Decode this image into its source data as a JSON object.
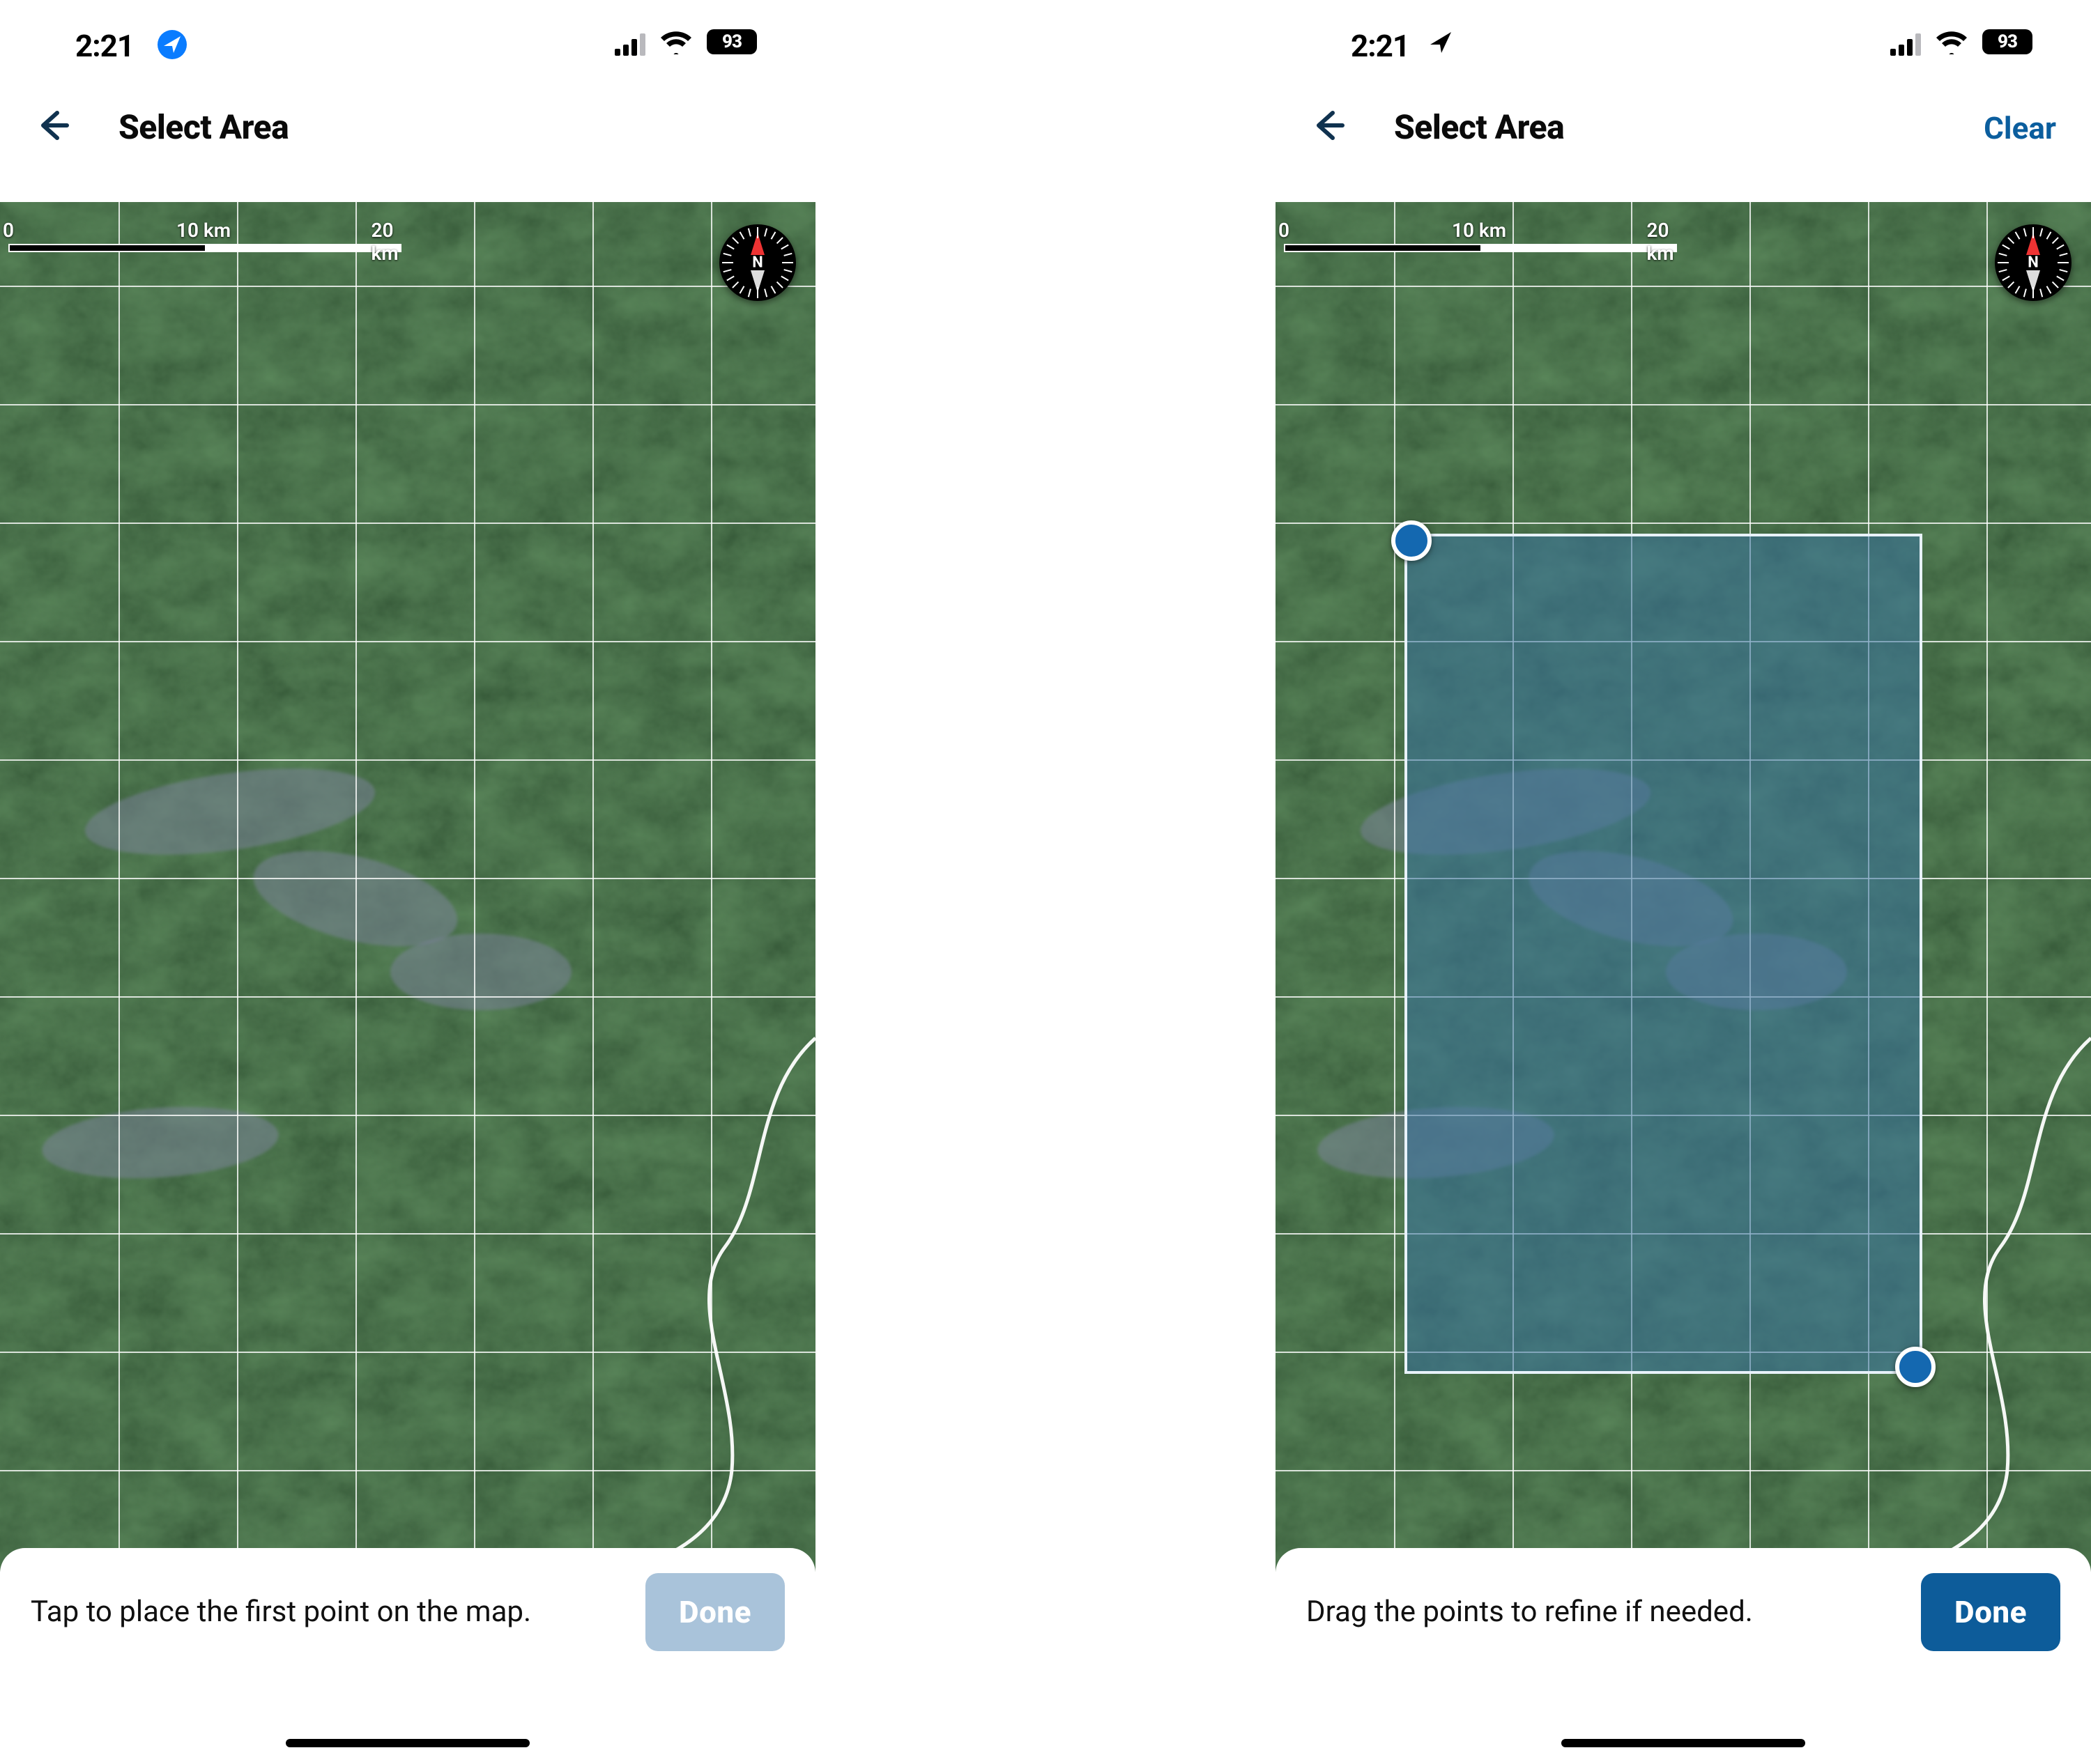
{
  "status": {
    "time": "2:21",
    "battery": "93"
  },
  "nav": {
    "title": "Select Area",
    "clear_label": "Clear"
  },
  "scale": {
    "zero": "0",
    "mid": "10 km",
    "end": "20 km"
  },
  "compass": {
    "north": "N"
  },
  "left": {
    "instruction": "Tap to place the first point on the map.",
    "done_label": "Done"
  },
  "right": {
    "instruction": "Drag the points to refine if needed.",
    "done_label": "Done"
  }
}
